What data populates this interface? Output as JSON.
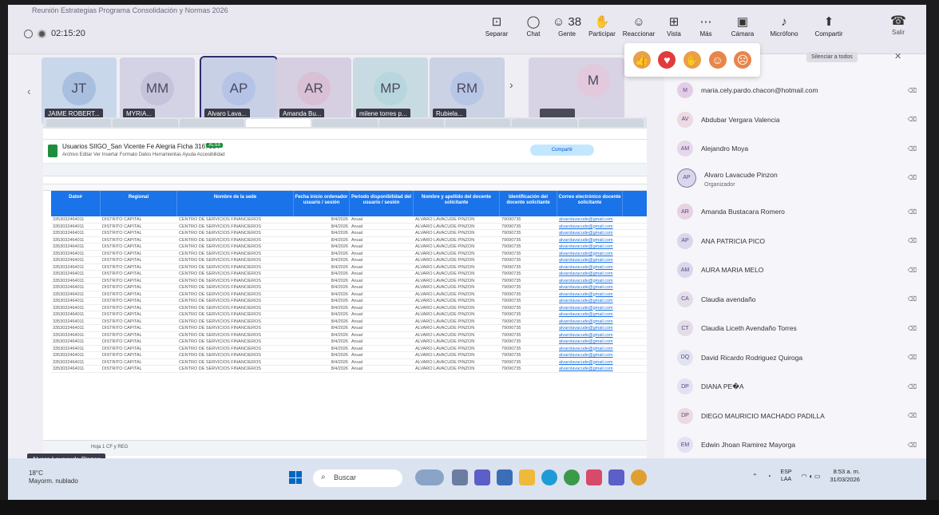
{
  "window": {
    "title": "Reunión Estrategias Programa Consolidación y Normas 2026",
    "timer": "02:15:20"
  },
  "toolbar": [
    {
      "label": "Separar",
      "icon": "pin-icon"
    },
    {
      "label": "Chat",
      "icon": "chat-icon"
    },
    {
      "label": "Gente",
      "icon": "people-icon",
      "count": "38"
    },
    {
      "label": "Participar",
      "icon": "raise-hand-icon"
    },
    {
      "label": "Reaccionar",
      "icon": "smile-icon"
    },
    {
      "label": "Vista",
      "icon": "grid-view-icon"
    },
    {
      "label": "Más",
      "icon": "more-icon"
    },
    {
      "label": "Cámara",
      "icon": "camera-icon"
    },
    {
      "label": "Micrófono",
      "icon": "mic-icon"
    },
    {
      "label": "Compartir",
      "icon": "share-icon"
    }
  ],
  "leave": {
    "label": "Salir",
    "icon": "phone-leave-icon"
  },
  "reactions": [
    "thumbs-up-icon",
    "heart-icon",
    "clap-icon",
    "laugh-icon",
    "surprised-icon"
  ],
  "tiles": [
    {
      "initials": "JT",
      "name": "JAIME ROBERT...",
      "bg": "#c9d7ea",
      "avbg": "#a8bfe0"
    },
    {
      "initials": "MM",
      "name": "MYRIA...",
      "bg": "#d3d3e5",
      "avbg": "#c5c3dc"
    },
    {
      "initials": "AP",
      "name": "Alvaro Lava...",
      "bg": "#c8d0e6",
      "avbg": "#b4c3e6"
    },
    {
      "initials": "AR",
      "name": "Amanda Bu...",
      "bg": "#d6cfe2",
      "avbg": "#d9c0d4"
    },
    {
      "initials": "MP",
      "name": "milene torres p...",
      "bg": "#c9dbe2",
      "avbg": "#b7d6de"
    },
    {
      "initials": "RM",
      "name": "Rubiela...",
      "bg": "#cad2e4",
      "avbg": "#b8c6e6"
    },
    {
      "initials": "M",
      "name": "",
      "bg": "#d8d3e4",
      "avbg": "#e2c9dc"
    }
  ],
  "panel": {
    "silence_label": "Silenciar a todos",
    "close_label": "✕"
  },
  "participants": [
    {
      "initials": "M",
      "name": "maria.cely.pardo.chacon@hotmail.com",
      "role": ""
    },
    {
      "initials": "AV",
      "name": "Abdubar Vergara Valencia",
      "role": ""
    },
    {
      "initials": "AM",
      "name": "Alejandro Moya",
      "role": ""
    },
    {
      "initials": "AP",
      "name": "Alvaro Lavacude Pinzon",
      "role": "Organizador"
    },
    {
      "initials": "AR",
      "name": "Amanda Bustacara Romero",
      "role": ""
    },
    {
      "initials": "AP",
      "name": "ANA PATRICIA PICO",
      "role": ""
    },
    {
      "initials": "AM",
      "name": "AURA MARIA MELO",
      "role": ""
    },
    {
      "initials": "CA",
      "name": "Claudia avendaño",
      "role": ""
    },
    {
      "initials": "CT",
      "name": "Claudia Liceth Avendaño Torres",
      "role": ""
    },
    {
      "initials": "DQ",
      "name": "David Ricardo Rodriguez Quiroga",
      "role": ""
    },
    {
      "initials": "DP",
      "name": "DIANA PE�A",
      "role": ""
    },
    {
      "initials": "DP",
      "name": "DIEGO MAURICIO MACHADO PADILLA",
      "role": ""
    },
    {
      "initials": "EM",
      "name": "Edwin Jhoan Ramirez Mayorga",
      "role": ""
    }
  ],
  "sheet": {
    "title": "Usuarios SIIGO_San Vicente Fe Alegria Ficha 3167084",
    "badge": "XLSX",
    "menu": "Archivo  Editar  Ver  Insertar  Formato  Datos  Herramientas  Ayuda  Accesibilidad",
    "share_label": "Compartir",
    "headers": [
      "Dato#",
      "Regional",
      "Nombre de la sede",
      "Fecha inicio ordenador usuario / sesión",
      "Periodo disponibilidad del usuario / sesión",
      "Nombre y apellido del docente solicitante",
      "Identificación del docente solicitante",
      "Correo electrónico docente solicitante"
    ],
    "row_template": {
      "dato": "3353032464011",
      "regional": "DISTRITO CAPITAL",
      "sede": "CENTRO DE SERVICIOS FINANCIEROS",
      "fecha": "8/4/2026",
      "periodo": "Anual",
      "docente": "ALVARO LAVACUDE PINZON",
      "id": "79090735",
      "correo": "alvarolavacude@gmail.com"
    },
    "rows_count": 23,
    "tabs": "Hoja 1   CF y REG"
  },
  "you_badge": "Alvaro Lavacude Pinzon",
  "taskbar": {
    "temp": "18°C",
    "weather": "Mayorm. nublado",
    "search": "Buscar",
    "lang1": "ESP",
    "lang2": "LAA",
    "time": "8:53 a. m.",
    "date": "31/03/2026"
  },
  "colors": {
    "accent": "#5b5fc7",
    "sheet_header": "#1a73e8",
    "taskbar": "#dbe3f0"
  }
}
